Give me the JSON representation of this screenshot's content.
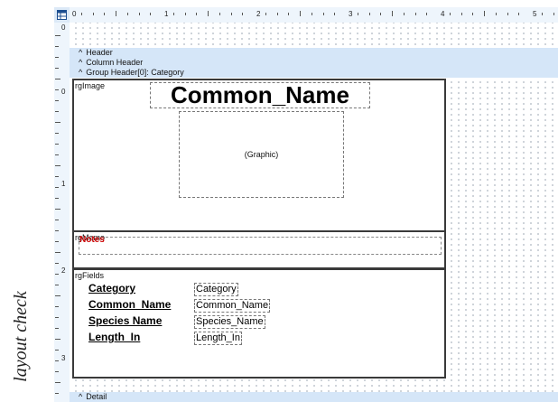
{
  "caption": "layout check",
  "ruler": {
    "horizontal_numbers": [
      "0",
      "1",
      "2",
      "3",
      "4",
      "5"
    ],
    "vertical_numbers": [
      "0",
      "0",
      "1",
      "2",
      "3"
    ]
  },
  "bands": {
    "header": "Header",
    "column_header": "Column Header",
    "group_header": "Group Header[0]: Category",
    "detail": "Detail"
  },
  "image_frame": {
    "name": "rgImage",
    "title_field": "Common_Name",
    "graphic_label": "(Graphic)"
  },
  "memo_frame": {
    "name": "rgMemo",
    "notes_label": "Notes"
  },
  "fields_frame": {
    "name": "rgFields",
    "rows": [
      {
        "label": "Category",
        "value": "Category"
      },
      {
        "label": "Common_Name",
        "value": "Common_Name"
      },
      {
        "label": "Species Name",
        "value": "Species_Name"
      },
      {
        "label": "Length_In",
        "value": "Length_In"
      }
    ]
  },
  "colors": {
    "band_background": "#d5e6f8",
    "notes_text": "#cc0000",
    "frame_border": "#3a3a3a"
  }
}
